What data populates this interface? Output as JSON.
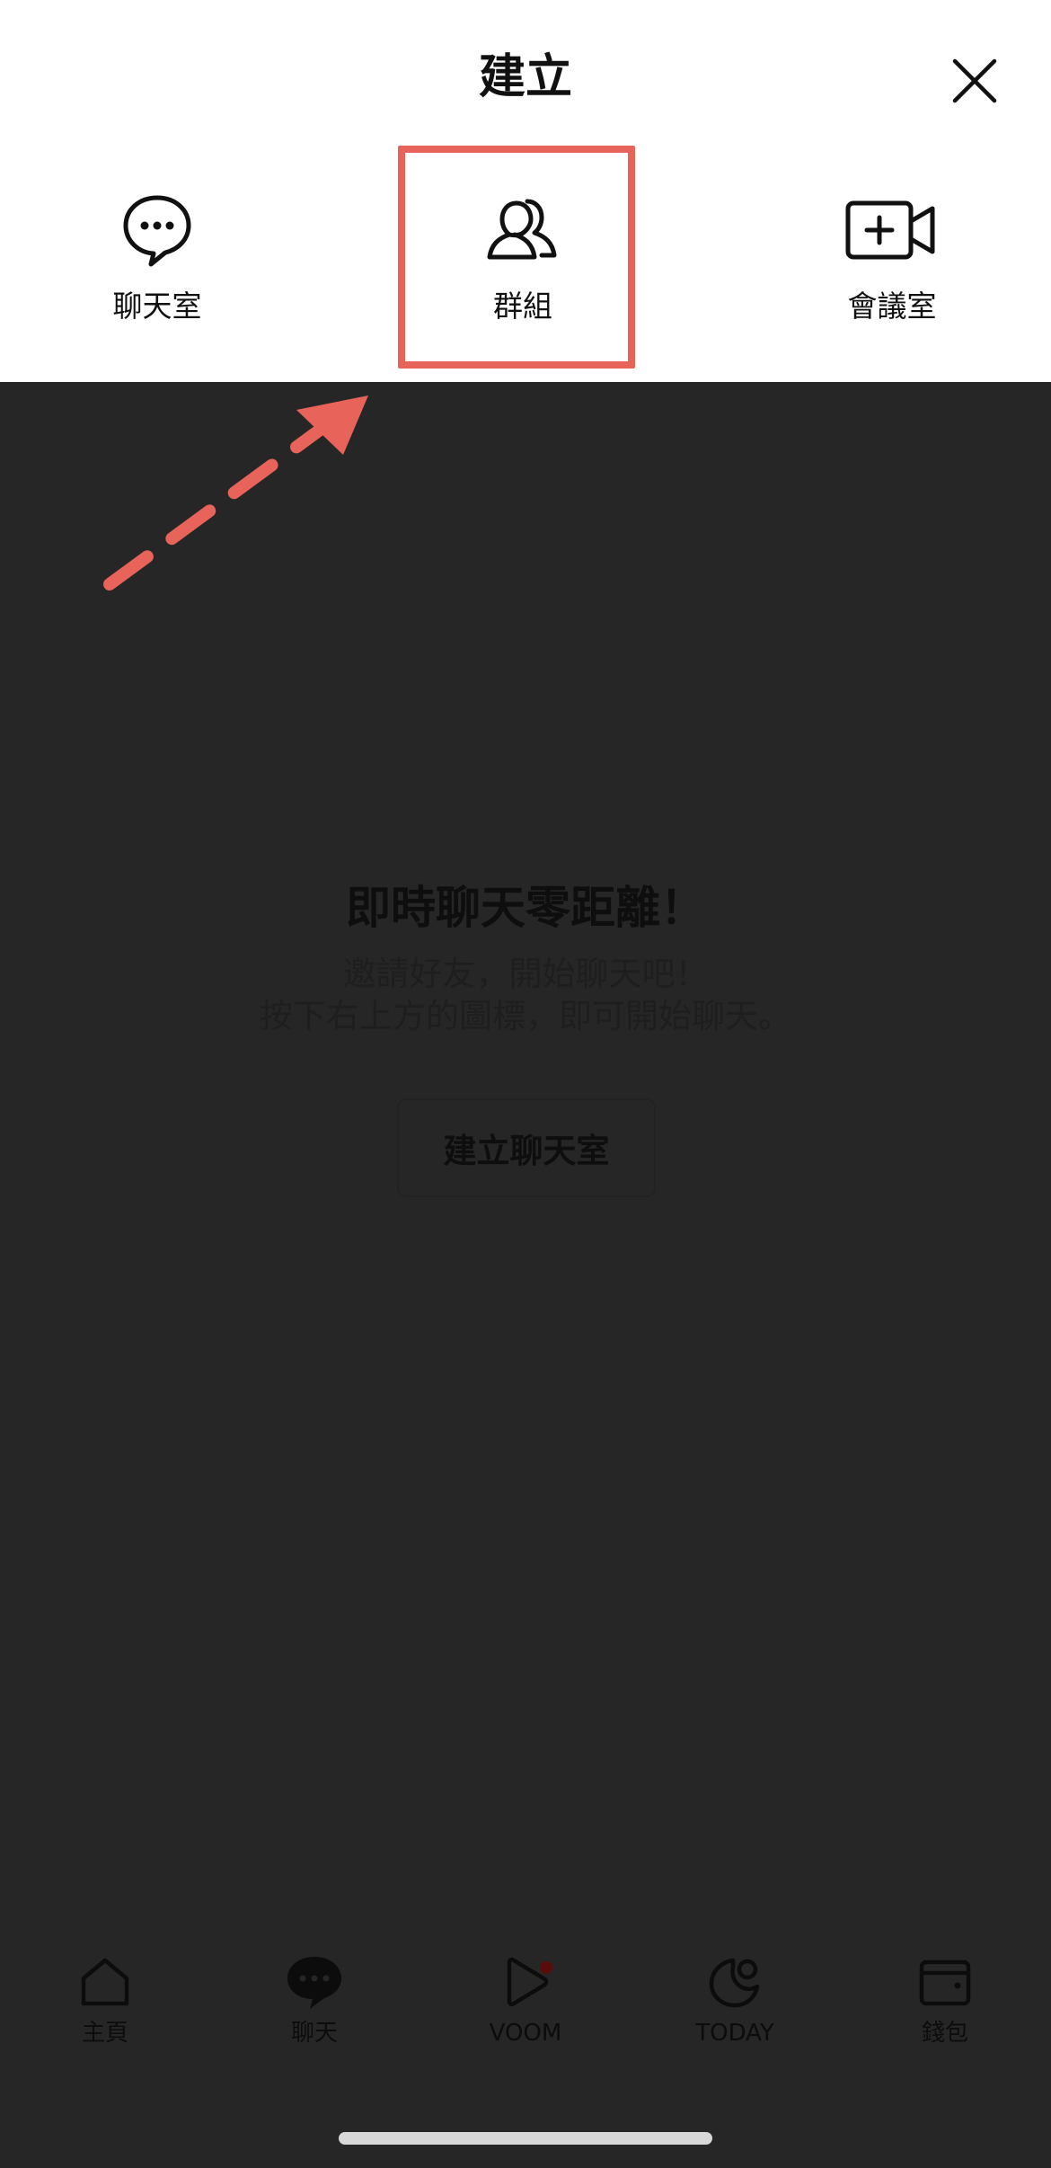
{
  "header": {
    "title": "建立"
  },
  "create_options": [
    {
      "label": "聊天室",
      "icon": "chat-bubble-icon"
    },
    {
      "label": "群組",
      "icon": "group-icon"
    },
    {
      "label": "會議室",
      "icon": "video-add-icon"
    }
  ],
  "annotation": {
    "highlight_color": "#e8635a"
  },
  "empty_state": {
    "title": "即時聊天零距離！",
    "line1": "邀請好友，開始聊天吧！",
    "line2": "按下右上方的圖標，即可開始聊天。",
    "button_label": "建立聊天室"
  },
  "bottom_nav": [
    {
      "label": "主頁",
      "icon": "home-icon"
    },
    {
      "label": "聊天",
      "icon": "chat-icon"
    },
    {
      "label": "VOOM",
      "icon": "voom-icon"
    },
    {
      "label": "TODAY",
      "icon": "today-icon"
    },
    {
      "label": "錢包",
      "icon": "wallet-icon"
    }
  ],
  "colors": {
    "overlay": "#262626",
    "sheet": "#ffffff",
    "accent": "#e8635a"
  }
}
